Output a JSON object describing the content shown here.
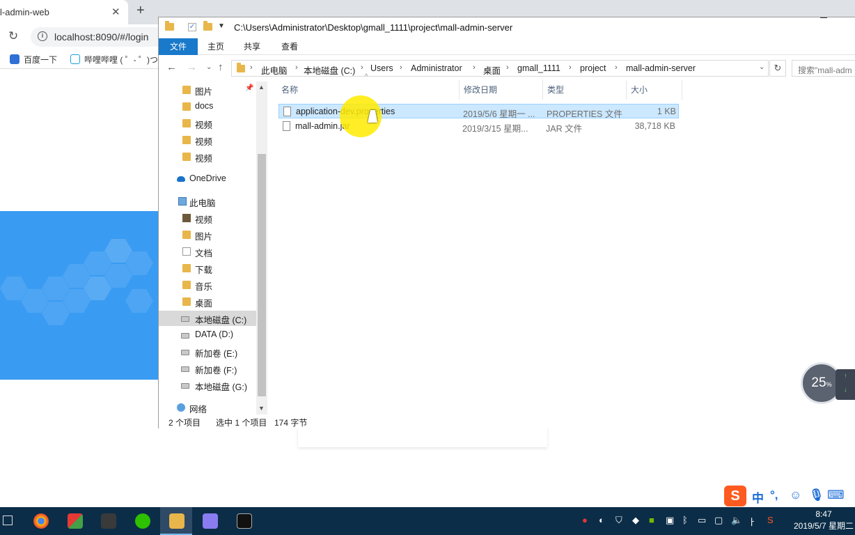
{
  "browser": {
    "tab_title": "l-admin-web",
    "tab_close": "✕",
    "new_tab": "+",
    "url": "localhost:8090/#/login",
    "bookmarks": [
      {
        "label": "百度一下"
      },
      {
        "label": "哔哩哔哩 ( ゜- ゜)つ"
      }
    ]
  },
  "explorer": {
    "title_path": "C:\\Users\\Administrator\\Desktop\\gmall_1111\\project\\mall-admin-server",
    "ribbon_tabs": [
      "文件",
      "主页",
      "共享",
      "查看"
    ],
    "breadcrumbs": [
      "此电脑",
      "本地磁盘 (C:)",
      "Users",
      "Administrator",
      "桌面",
      "gmall_1111",
      "project",
      "mall-admin-server"
    ],
    "search_placeholder": "搜索\"mall-adm",
    "nav_items": [
      {
        "label": "图片"
      },
      {
        "label": "docs"
      },
      {
        "label": "视频"
      },
      {
        "label": "视频"
      },
      {
        "label": "视频"
      },
      {
        "label": "OneDrive"
      },
      {
        "label": "此电脑"
      },
      {
        "label": "视频"
      },
      {
        "label": "图片"
      },
      {
        "label": "文档"
      },
      {
        "label": "下载"
      },
      {
        "label": "音乐"
      },
      {
        "label": "桌面"
      },
      {
        "label": "本地磁盘 (C:)"
      },
      {
        "label": "DATA (D:)"
      },
      {
        "label": "新加卷 (E:)"
      },
      {
        "label": "新加卷 (F:)"
      },
      {
        "label": "本地磁盘 (G:)"
      },
      {
        "label": "网络"
      }
    ],
    "columns": [
      "名称",
      "修改日期",
      "类型",
      "大小"
    ],
    "files": [
      {
        "name": "application-dev.properties",
        "date": "2019/5/6 星期一 ...",
        "type": "PROPERTIES 文件",
        "size": "1 KB",
        "selected": true
      },
      {
        "name": "mall-admin.jar",
        "date": "2019/3/15 星期...",
        "type": "JAR 文件",
        "size": "38,718 KB",
        "selected": false
      }
    ],
    "status": {
      "item_count": "2 个项目",
      "selected": "选中 1 个项目",
      "bytes": "174 字节"
    }
  },
  "widgets": {
    "gauge_value": "25",
    "gauge_unit": "%",
    "ime_chars": [
      "中",
      "°,"
    ]
  },
  "taskbar": {
    "time": "8:47",
    "date": "2019/5/7 星期二"
  },
  "colors": {
    "accent": "#1979ca",
    "hero_blue": "#3a9bf2",
    "selection": "#cce8ff",
    "taskbar": "#0c2d48"
  }
}
